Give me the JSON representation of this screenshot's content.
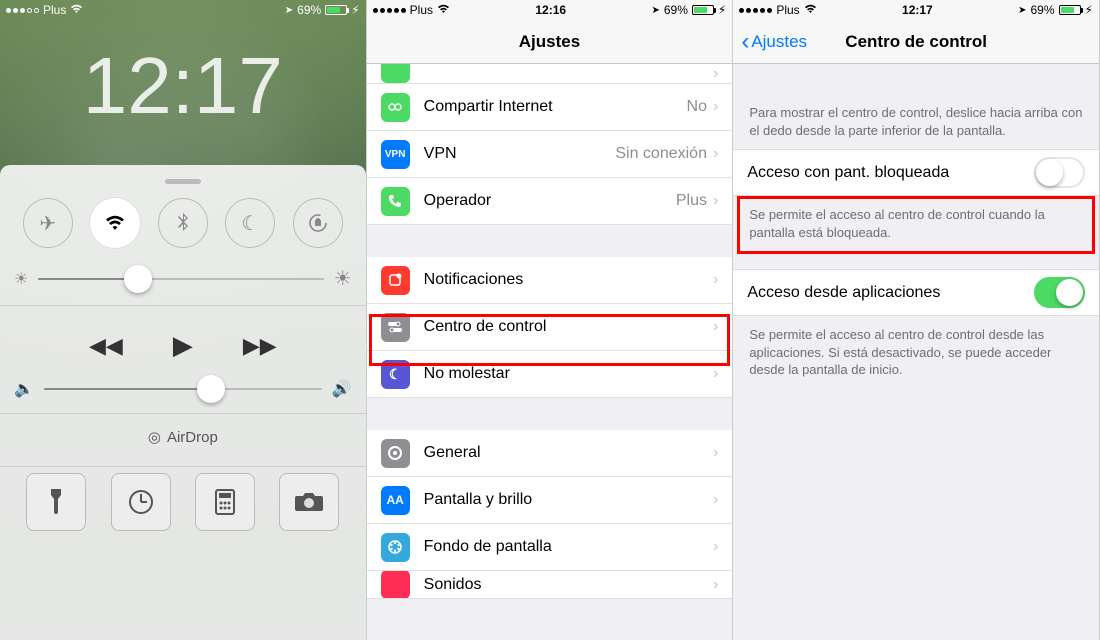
{
  "panel1": {
    "status": {
      "carrier": "Plus",
      "battery_pct": "69%",
      "time": "12:17"
    },
    "lock_time": "12:17",
    "brightness_pct": 35,
    "volume_pct": 60,
    "airdrop_label": "AirDrop",
    "toggles": {
      "airplane": "airplane-icon",
      "wifi": "wifi-icon",
      "bluetooth": "bluetooth-icon",
      "dnd": "moon-icon",
      "lock": "orientation-lock-icon"
    },
    "shortcuts": {
      "torch": "flashlight-icon",
      "timer": "timer-icon",
      "calc": "calculator-icon",
      "camera": "camera-icon"
    }
  },
  "panel2": {
    "status": {
      "carrier": "Plus",
      "time": "12:16",
      "battery_pct": "69%"
    },
    "nav_title": "Ajustes",
    "rows": {
      "hotspot": {
        "label": "Compartir Internet",
        "detail": "No"
      },
      "vpn": {
        "label": "VPN",
        "badge": "VPN",
        "detail": "Sin conexión"
      },
      "carrier": {
        "label": "Operador",
        "detail": "Plus"
      },
      "notifications": {
        "label": "Notificaciones"
      },
      "controlcenter": {
        "label": "Centro de control"
      },
      "dnd": {
        "label": "No molestar"
      },
      "general": {
        "label": "General"
      },
      "display": {
        "label": "Pantalla y brillo"
      },
      "wallpaper": {
        "label": "Fondo de pantalla"
      },
      "sounds": {
        "label": "Sonidos"
      }
    }
  },
  "panel3": {
    "status": {
      "carrier": "Plus",
      "time": "12:17",
      "battery_pct": "69%"
    },
    "nav_back": "Ajustes",
    "nav_title": "Centro de control",
    "note1": "Para mostrar el centro de control, deslice hacia arriba con el dedo desde la parte inferior de la pantalla.",
    "row1_label": "Acceso con pant. bloqueada",
    "note2": "Se permite el acceso al centro de control cuando la pantalla está bloqueada.",
    "row2_label": "Acceso desde aplicaciones",
    "note3": "Se permite el acceso al centro de control desde las aplicaciones. Si está desactivado, se puede acceder desde la pantalla de inicio."
  }
}
